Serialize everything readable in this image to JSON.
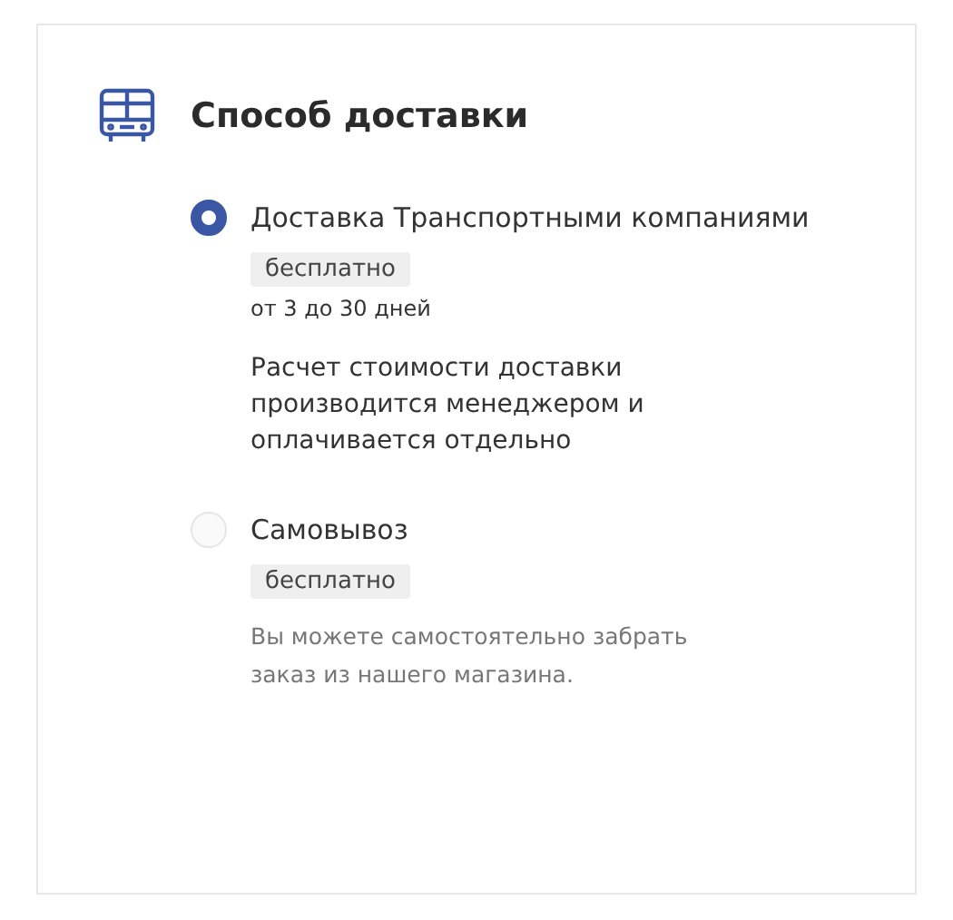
{
  "section": {
    "title": "Способ доставки"
  },
  "options": [
    {
      "label": "Доставка Транспортными компаниями",
      "selected": true,
      "price": "бесплатно",
      "term": "от 3 до 30 дней",
      "description": {
        "kind": "info",
        "text": "Расчет стоимости доставки производится менеджером и оплачивается отдельно"
      }
    },
    {
      "label": "Самовывоз",
      "selected": false,
      "price": "бесплатно",
      "description": {
        "kind": "hint",
        "text": "Вы можете самостоятельно забрать заказ из нашего магазина."
      }
    }
  ]
}
